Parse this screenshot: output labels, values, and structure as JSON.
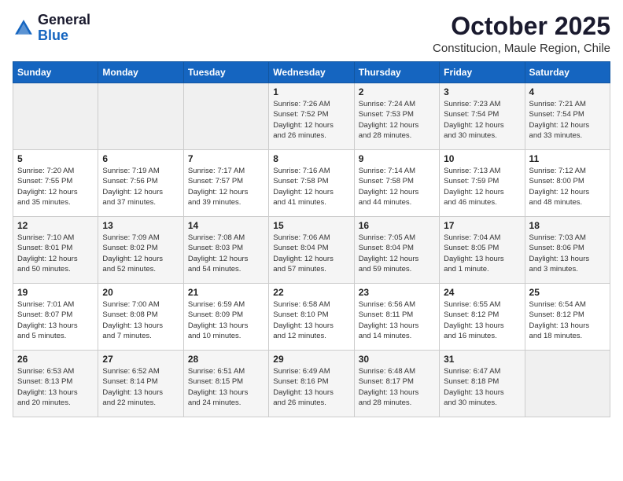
{
  "header": {
    "logo_general": "General",
    "logo_blue": "Blue",
    "month": "October 2025",
    "location": "Constitucion, Maule Region, Chile"
  },
  "days_of_week": [
    "Sunday",
    "Monday",
    "Tuesday",
    "Wednesday",
    "Thursday",
    "Friday",
    "Saturday"
  ],
  "weeks": [
    [
      {
        "day": "",
        "info": ""
      },
      {
        "day": "",
        "info": ""
      },
      {
        "day": "",
        "info": ""
      },
      {
        "day": "1",
        "info": "Sunrise: 7:26 AM\nSunset: 7:52 PM\nDaylight: 12 hours\nand 26 minutes."
      },
      {
        "day": "2",
        "info": "Sunrise: 7:24 AM\nSunset: 7:53 PM\nDaylight: 12 hours\nand 28 minutes."
      },
      {
        "day": "3",
        "info": "Sunrise: 7:23 AM\nSunset: 7:54 PM\nDaylight: 12 hours\nand 30 minutes."
      },
      {
        "day": "4",
        "info": "Sunrise: 7:21 AM\nSunset: 7:54 PM\nDaylight: 12 hours\nand 33 minutes."
      }
    ],
    [
      {
        "day": "5",
        "info": "Sunrise: 7:20 AM\nSunset: 7:55 PM\nDaylight: 12 hours\nand 35 minutes."
      },
      {
        "day": "6",
        "info": "Sunrise: 7:19 AM\nSunset: 7:56 PM\nDaylight: 12 hours\nand 37 minutes."
      },
      {
        "day": "7",
        "info": "Sunrise: 7:17 AM\nSunset: 7:57 PM\nDaylight: 12 hours\nand 39 minutes."
      },
      {
        "day": "8",
        "info": "Sunrise: 7:16 AM\nSunset: 7:58 PM\nDaylight: 12 hours\nand 41 minutes."
      },
      {
        "day": "9",
        "info": "Sunrise: 7:14 AM\nSunset: 7:58 PM\nDaylight: 12 hours\nand 44 minutes."
      },
      {
        "day": "10",
        "info": "Sunrise: 7:13 AM\nSunset: 7:59 PM\nDaylight: 12 hours\nand 46 minutes."
      },
      {
        "day": "11",
        "info": "Sunrise: 7:12 AM\nSunset: 8:00 PM\nDaylight: 12 hours\nand 48 minutes."
      }
    ],
    [
      {
        "day": "12",
        "info": "Sunrise: 7:10 AM\nSunset: 8:01 PM\nDaylight: 12 hours\nand 50 minutes."
      },
      {
        "day": "13",
        "info": "Sunrise: 7:09 AM\nSunset: 8:02 PM\nDaylight: 12 hours\nand 52 minutes."
      },
      {
        "day": "14",
        "info": "Sunrise: 7:08 AM\nSunset: 8:03 PM\nDaylight: 12 hours\nand 54 minutes."
      },
      {
        "day": "15",
        "info": "Sunrise: 7:06 AM\nSunset: 8:04 PM\nDaylight: 12 hours\nand 57 minutes."
      },
      {
        "day": "16",
        "info": "Sunrise: 7:05 AM\nSunset: 8:04 PM\nDaylight: 12 hours\nand 59 minutes."
      },
      {
        "day": "17",
        "info": "Sunrise: 7:04 AM\nSunset: 8:05 PM\nDaylight: 13 hours\nand 1 minute."
      },
      {
        "day": "18",
        "info": "Sunrise: 7:03 AM\nSunset: 8:06 PM\nDaylight: 13 hours\nand 3 minutes."
      }
    ],
    [
      {
        "day": "19",
        "info": "Sunrise: 7:01 AM\nSunset: 8:07 PM\nDaylight: 13 hours\nand 5 minutes."
      },
      {
        "day": "20",
        "info": "Sunrise: 7:00 AM\nSunset: 8:08 PM\nDaylight: 13 hours\nand 7 minutes."
      },
      {
        "day": "21",
        "info": "Sunrise: 6:59 AM\nSunset: 8:09 PM\nDaylight: 13 hours\nand 10 minutes."
      },
      {
        "day": "22",
        "info": "Sunrise: 6:58 AM\nSunset: 8:10 PM\nDaylight: 13 hours\nand 12 minutes."
      },
      {
        "day": "23",
        "info": "Sunrise: 6:56 AM\nSunset: 8:11 PM\nDaylight: 13 hours\nand 14 minutes."
      },
      {
        "day": "24",
        "info": "Sunrise: 6:55 AM\nSunset: 8:12 PM\nDaylight: 13 hours\nand 16 minutes."
      },
      {
        "day": "25",
        "info": "Sunrise: 6:54 AM\nSunset: 8:12 PM\nDaylight: 13 hours\nand 18 minutes."
      }
    ],
    [
      {
        "day": "26",
        "info": "Sunrise: 6:53 AM\nSunset: 8:13 PM\nDaylight: 13 hours\nand 20 minutes."
      },
      {
        "day": "27",
        "info": "Sunrise: 6:52 AM\nSunset: 8:14 PM\nDaylight: 13 hours\nand 22 minutes."
      },
      {
        "day": "28",
        "info": "Sunrise: 6:51 AM\nSunset: 8:15 PM\nDaylight: 13 hours\nand 24 minutes."
      },
      {
        "day": "29",
        "info": "Sunrise: 6:49 AM\nSunset: 8:16 PM\nDaylight: 13 hours\nand 26 minutes."
      },
      {
        "day": "30",
        "info": "Sunrise: 6:48 AM\nSunset: 8:17 PM\nDaylight: 13 hours\nand 28 minutes."
      },
      {
        "day": "31",
        "info": "Sunrise: 6:47 AM\nSunset: 8:18 PM\nDaylight: 13 hours\nand 30 minutes."
      },
      {
        "day": "",
        "info": ""
      }
    ]
  ]
}
